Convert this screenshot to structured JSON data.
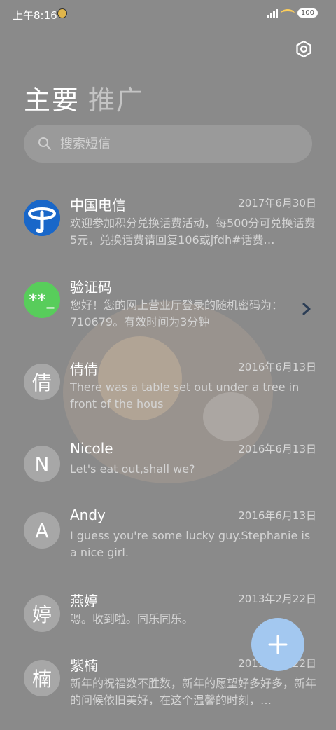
{
  "status_bar": {
    "time": "上午8:16",
    "battery": "100"
  },
  "tabs": {
    "main": "主要",
    "promo": "推广"
  },
  "search": {
    "placeholder": "搜索短信"
  },
  "messages": [
    {
      "avatar": "",
      "sender": "中国电信",
      "date": "2017年6月30日",
      "preview": "欢迎参加积分兑换话费活动，每500分可兑换话费5元，兑换话费请回复106或jfdh#话费…"
    },
    {
      "avatar": "**_",
      "sender": "验证码",
      "date": "",
      "preview": "您好！您的网上营业厅登录的随机密码为：710679。有效时间为3分钟"
    },
    {
      "avatar": "倩",
      "sender": "倩倩",
      "date": "2016年6月13日",
      "preview": "There was a table set out under a tree in front of the hous"
    },
    {
      "avatar": "N",
      "sender": "Nicole",
      "date": "2016年6月13日",
      "preview": "Let's eat out,shall we?"
    },
    {
      "avatar": "A",
      "sender": "Andy",
      "date": "2016年6月13日",
      "preview": "I guess you're some lucky guy.Stephanie is a nice girl."
    },
    {
      "avatar": "婷",
      "sender": "燕婷",
      "date": "2013年2月22日",
      "preview": "嗯。收到啦。同乐同乐。"
    },
    {
      "avatar": "楠",
      "sender": "紫楠",
      "date": "2013年2月22日",
      "preview": "新年的祝福数不胜数，新年的愿望好多好多，新年的问候依旧美好，在这个温馨的时刻，…"
    }
  ],
  "icons": {
    "settings": "gear-icon",
    "search": "search-icon",
    "compose": "plus-icon",
    "expand": "chevron-right-icon"
  }
}
